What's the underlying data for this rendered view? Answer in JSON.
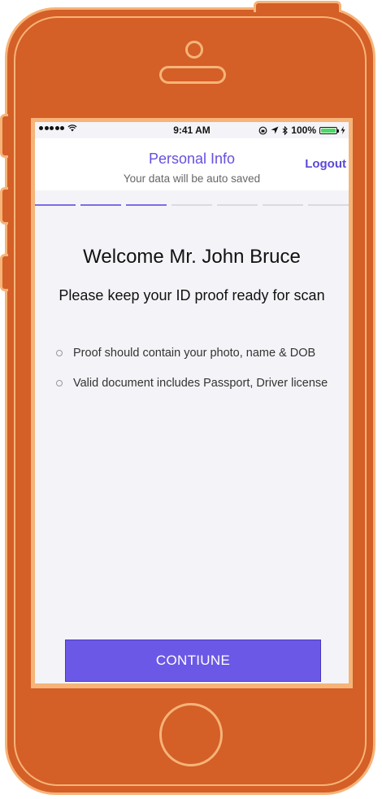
{
  "status_bar": {
    "time": "9:41 AM",
    "battery_percent": "100%",
    "signal_dots": 5,
    "battery_level": 1.0,
    "battery_color": "#4cd964"
  },
  "header": {
    "title": "Personal Info",
    "subtitle": "Your data will be auto saved",
    "logout_label": "Logout",
    "progress_steps_total": 7,
    "progress_steps_done": 3,
    "accent_color": "#6650de"
  },
  "main": {
    "welcome": "Welcome Mr. John Bruce",
    "instruction": "Please keep your ID proof ready for scan",
    "items": [
      {
        "text": "Proof should contain your photo, name & DOB"
      },
      {
        "text": "Valid document includes Passport, Driver license"
      }
    ]
  },
  "footer": {
    "continue_label": "CONTIUNE",
    "button_color": "#6b58e6"
  },
  "device": {
    "body_color": "#d45f27",
    "outline_color": "#f6b479"
  }
}
